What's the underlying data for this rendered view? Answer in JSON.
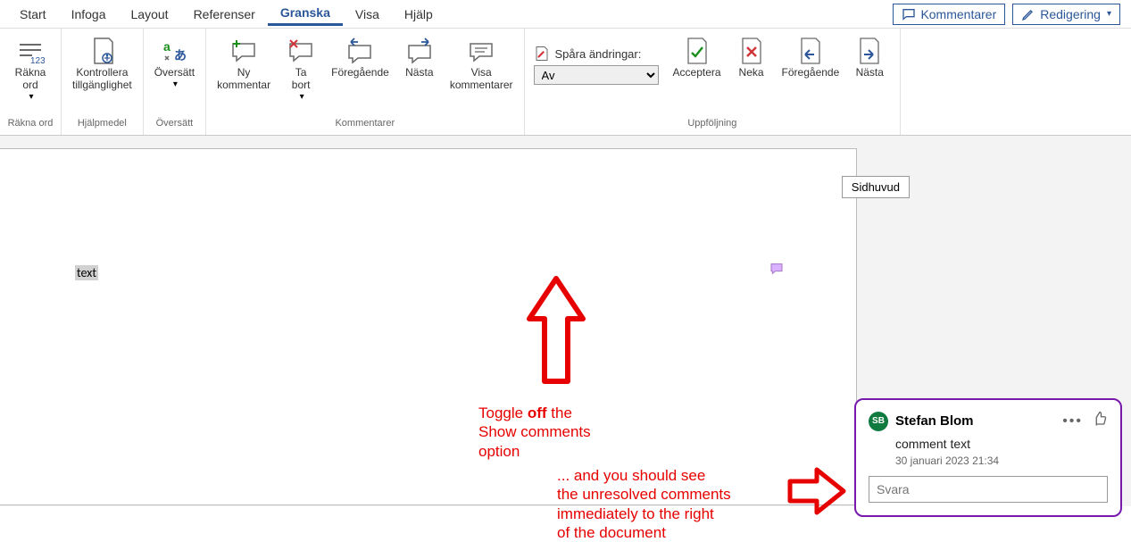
{
  "tabs": {
    "items": [
      "Start",
      "Infoga",
      "Layout",
      "Referenser",
      "Granska",
      "Visa",
      "Hjälp"
    ],
    "activeIndex": 4
  },
  "topRight": {
    "comments": "Kommentarer",
    "editing": "Redigering"
  },
  "ribbon": {
    "wordcount": {
      "btn": "Räkna\nord",
      "group": "Räkna ord"
    },
    "accessibility": {
      "btn": "Kontrollera\ntillgänglighet",
      "group": "Hjälpmedel"
    },
    "translate": {
      "btn": "Översätt",
      "group": "Översätt"
    },
    "comments": {
      "new": "Ny\nkommentar",
      "del": "Ta\nbort",
      "prev": "Föregående",
      "next": "Nästa",
      "show": "Visa\nkommentarer",
      "group": "Kommentarer"
    },
    "tracking": {
      "track_label": "Spåra ändringar:",
      "track_value": "Av",
      "accept": "Acceptera",
      "reject": "Neka",
      "prev": "Föregående",
      "next": "Nästa",
      "group": "Uppföljning"
    }
  },
  "document": {
    "headerTag": "Sidhuvud",
    "text": "text"
  },
  "annotations": {
    "toggle_pre": "Toggle ",
    "toggle_bold": "off",
    "toggle_post": " the\nShow comments\noption",
    "see": "... and you should see\nthe unresolved comments\nimmediately to the right\nof the document"
  },
  "comment": {
    "avatar": "SB",
    "author": "Stefan Blom",
    "text": "comment text",
    "date": "30 januari 2023 21:34",
    "reply_placeholder": "Svara"
  }
}
